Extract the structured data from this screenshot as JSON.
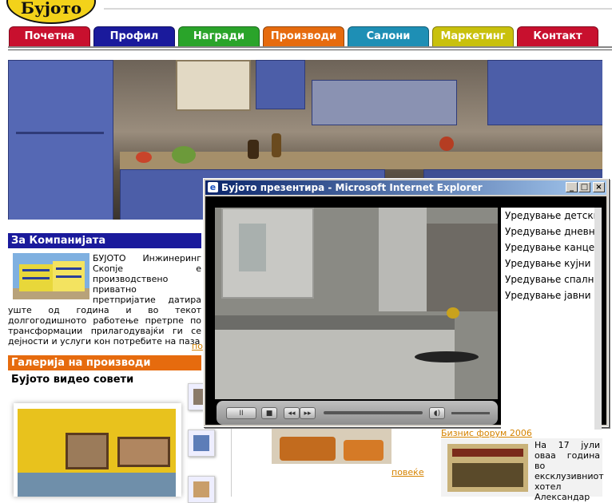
{
  "logo": {
    "text": "Бујото"
  },
  "nav": {
    "tabs": [
      {
        "label": "Почетна",
        "color": "#c8102e"
      },
      {
        "label": "Профил",
        "color": "#1a1a9c"
      },
      {
        "label": "Награди",
        "color": "#2aa42a"
      },
      {
        "label": "Производи",
        "color": "#e66b0e"
      },
      {
        "label": "Салони",
        "color": "#1e8fb5"
      },
      {
        "label": "Маркетинг",
        "color": "#c9c10d"
      },
      {
        "label": "Контакт",
        "color": "#c8102e"
      }
    ]
  },
  "company": {
    "heading": "За Компанијата",
    "heading_color": "#1a1a9c",
    "text": "БУЈОТО Инжинеринг Скопје е производствено приватно претпријатие датира уште од година и во текот долгогодишното работење претрпе по трансформации прилагодувајќи ги се дејности и услуги кон потребите на паза",
    "more": "по"
  },
  "gallery": {
    "heading": "Галерија на производи",
    "heading_color": "#e66b0e",
    "video_tips": "Бујото видео совети"
  },
  "news": {
    "more": "повеќе",
    "biz_title": "Бизнис форум 2006",
    "biz_text": "На 17 јули оваа година во ексклузивниот хотел Александар"
  },
  "popup": {
    "title": "Бујото презентира - Microsoft Internet Explorer",
    "minimize": "_",
    "maximize": "□",
    "close": "×",
    "menu": [
      "Уредување детски",
      "Уредување дневни",
      "Уредување канцела",
      "Уредување кујни",
      "Уредување спални",
      "Уредување јавни об"
    ],
    "player": {
      "pause": "II",
      "stop": "■",
      "prev": "◂◂",
      "next": "▸▸",
      "volume": "◖)"
    }
  }
}
